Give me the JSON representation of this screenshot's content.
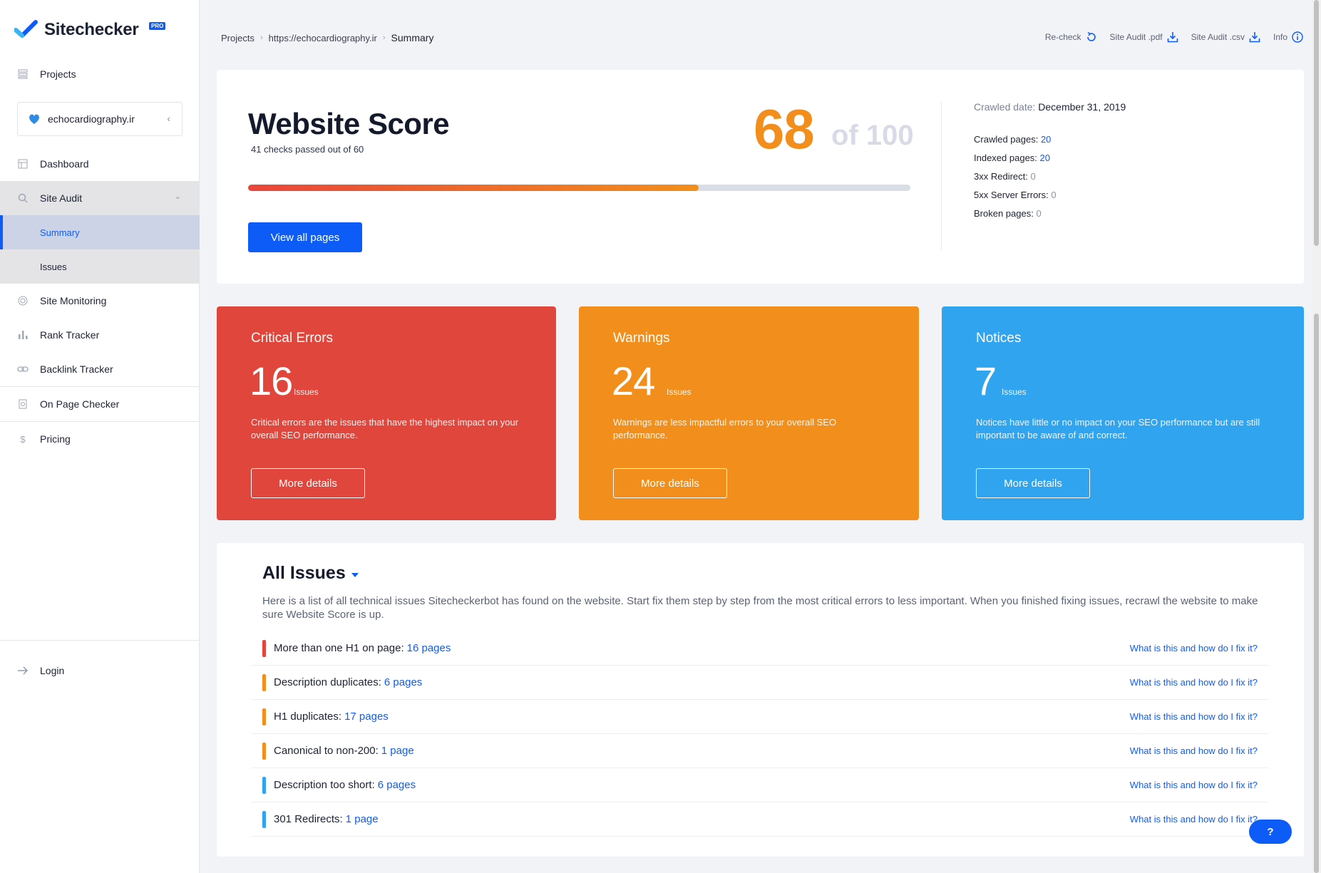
{
  "app": {
    "name": "Sitechecker",
    "badge": "PRO"
  },
  "sidebar": {
    "projects_label": "Projects",
    "project_name": "echocardiography.ir",
    "items": [
      {
        "label": "Dashboard",
        "icon": "dashboard-icon"
      },
      {
        "label": "Site Audit",
        "icon": "site-audit-icon"
      },
      {
        "label": "Site Monitoring",
        "icon": "monitoring-icon"
      },
      {
        "label": "Rank Tracker",
        "icon": "bar-chart-icon"
      },
      {
        "label": "Backlink Tracker",
        "icon": "link-icon"
      },
      {
        "label": "On Page Checker",
        "icon": "page-check-icon"
      },
      {
        "label": "Pricing",
        "icon": "dollar-icon"
      }
    ],
    "sub_items": [
      "Summary",
      "Issues"
    ],
    "login_label": "Login"
  },
  "breadcrumb": {
    "items": [
      "Projects",
      "https://echocardiography.ir",
      "Summary"
    ]
  },
  "toolbar": {
    "recheck": "Re-check",
    "pdf": "Site Audit .pdf",
    "csv": "Site Audit .csv",
    "info": "Info"
  },
  "score": {
    "title": "Website Score",
    "subtitle": "41 checks passed out of 60",
    "value": "68",
    "of_label": "of 100",
    "progress_fraction": 0.68,
    "button": "View all pages",
    "crawled_date_label": "Crawled date:",
    "crawled_date": "December 31, 2019",
    "stats": [
      {
        "label": "Crawled pages:",
        "value": "20",
        "style": "blue"
      },
      {
        "label": "Indexed pages:",
        "value": "20",
        "style": "blue"
      },
      {
        "label": "3xx Redirect:",
        "value": "0",
        "style": "grey"
      },
      {
        "label": "5xx Server Errors:",
        "value": "0",
        "style": "grey"
      },
      {
        "label": "Broken pages:",
        "value": "0",
        "style": "grey"
      }
    ]
  },
  "cards": [
    {
      "title": "Critical Errors",
      "count": "16",
      "unit": "Issues",
      "desc": "Critical errors are the issues that have the highest impact on your overall SEO performance.",
      "button": "More details",
      "color": "#e0463b"
    },
    {
      "title": "Warnings",
      "count": "24",
      "unit": "Issues",
      "desc": "Warnings are less impactful errors to your overall SEO performance.",
      "button": "More details",
      "color": "#f28f1c"
    },
    {
      "title": "Notices",
      "count": "7",
      "unit": "Issues",
      "desc": "Notices have little or no impact on your SEO performance but are still important to be aware of and correct.",
      "button": "More details",
      "color": "#31a4ef"
    }
  ],
  "issues": {
    "title": "All Issues",
    "description": "Here is a list of all technical issues Sitecheckerbot has found on the website. Start fix them step by step from the most critical errors to less important. When you finished fixing issues, recrawl the website to make sure Website Score is up.",
    "help_text": "What is this and how do I fix it?",
    "rows": [
      {
        "label": "More than one H1 on page:",
        "pages": "16 pages",
        "color": "#e0463b"
      },
      {
        "label": "Description duplicates:",
        "pages": "6 pages",
        "color": "#f28f1c"
      },
      {
        "label": "H1 duplicates:",
        "pages": "17 pages",
        "color": "#f28f1c"
      },
      {
        "label": "Canonical to non-200:",
        "pages": "1 page",
        "color": "#f28f1c"
      },
      {
        "label": "Description too short:",
        "pages": "6 pages",
        "color": "#31a4ef"
      },
      {
        "label": "301 Redirects:",
        "pages": "1 page",
        "color": "#31a4ef"
      }
    ]
  },
  "help_button": "?"
}
